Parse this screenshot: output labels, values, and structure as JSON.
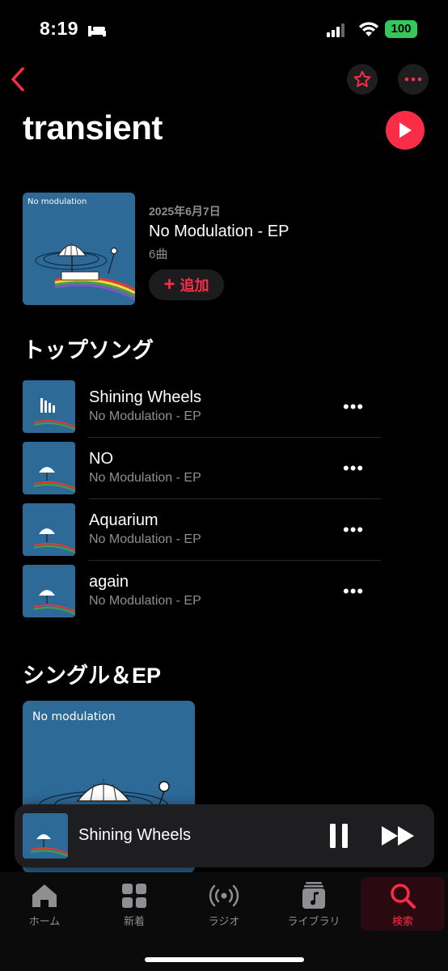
{
  "status_bar": {
    "time": "8:19",
    "battery": "100"
  },
  "artist": {
    "name": "transient"
  },
  "latest_release": {
    "date": "2025年6月7日",
    "title": "No Modulation - EP",
    "track_count": "6曲",
    "add_label": "追加",
    "art_text": "No modulation"
  },
  "top_songs": {
    "heading": "トップソング",
    "items": [
      {
        "title": "Shining Wheels",
        "album": "No Modulation - EP"
      },
      {
        "title": "NO",
        "album": "No Modulation - EP"
      },
      {
        "title": "Aquarium",
        "album": "No Modulation - EP"
      },
      {
        "title": "again",
        "album": "No Modulation - EP"
      }
    ]
  },
  "singles": {
    "heading": "シングル＆EP",
    "art_text": "No modulation"
  },
  "now_playing": {
    "title": "Shining Wheels"
  },
  "tabs": [
    {
      "label": "ホーム",
      "icon": "home-icon"
    },
    {
      "label": "新着",
      "icon": "grid-icon"
    },
    {
      "label": "ラジオ",
      "icon": "radio-icon"
    },
    {
      "label": "ライブラリ",
      "icon": "library-icon"
    },
    {
      "label": "検索",
      "icon": "search-icon",
      "active": true
    }
  ],
  "colors": {
    "accent": "#fa2d48",
    "background": "#000000",
    "secondary_text": "#8e8e93",
    "art_blue": "#2e6a98"
  }
}
